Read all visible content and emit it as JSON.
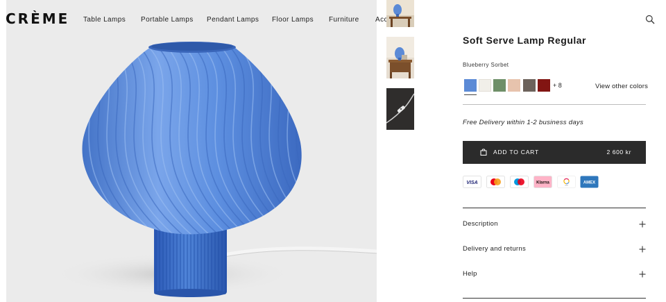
{
  "header": {
    "logo": "CRÈME",
    "nav": [
      "Table Lamps",
      "Portable Lamps",
      "Pendant Lamps",
      "Floor Lamps",
      "Furniture",
      "Accessories"
    ],
    "search_icon": "search-icon"
  },
  "product": {
    "title": "Soft Serve Lamp Regular",
    "color_name": "Blueberry Sorbet",
    "swatches": [
      "#5b8ad6",
      "#f1efe9",
      "#6e8f68",
      "#e7c3ad",
      "#6c625b",
      "#821512"
    ],
    "selected_swatch": 0,
    "more_colors": "+ 8",
    "view_other_colors": "View other colors",
    "delivery_note": "Free Delivery within 1-2 business days",
    "cart": {
      "label": "ADD TO CART",
      "price": "2 600 kr",
      "icon": "bag-icon"
    },
    "payment_methods": [
      "visa",
      "mastercard",
      "maestro",
      "klarna",
      "apple-pay-loop",
      "american-express"
    ],
    "payment_text": {
      "visa": "VISA",
      "klarna": "Klarna",
      "amex": "AMEX"
    },
    "accordion": [
      {
        "label": "Description",
        "icon": "plus-icon"
      },
      {
        "label": "Delivery and returns",
        "icon": "plus-icon"
      },
      {
        "label": "Help",
        "icon": "plus-icon"
      }
    ]
  },
  "gallery": {
    "thumbnails": [
      "lamp-on-table-thumbnail",
      "lamp-on-nightstand-thumbnail",
      "cable-switch-thumbnail"
    ],
    "main_image": "blue-swirl-lamp-photo"
  },
  "colors": {
    "lamp_blue": "#5b8ad6",
    "button_dark": "#2b2b2b",
    "image_bg": "#ebebeb"
  }
}
